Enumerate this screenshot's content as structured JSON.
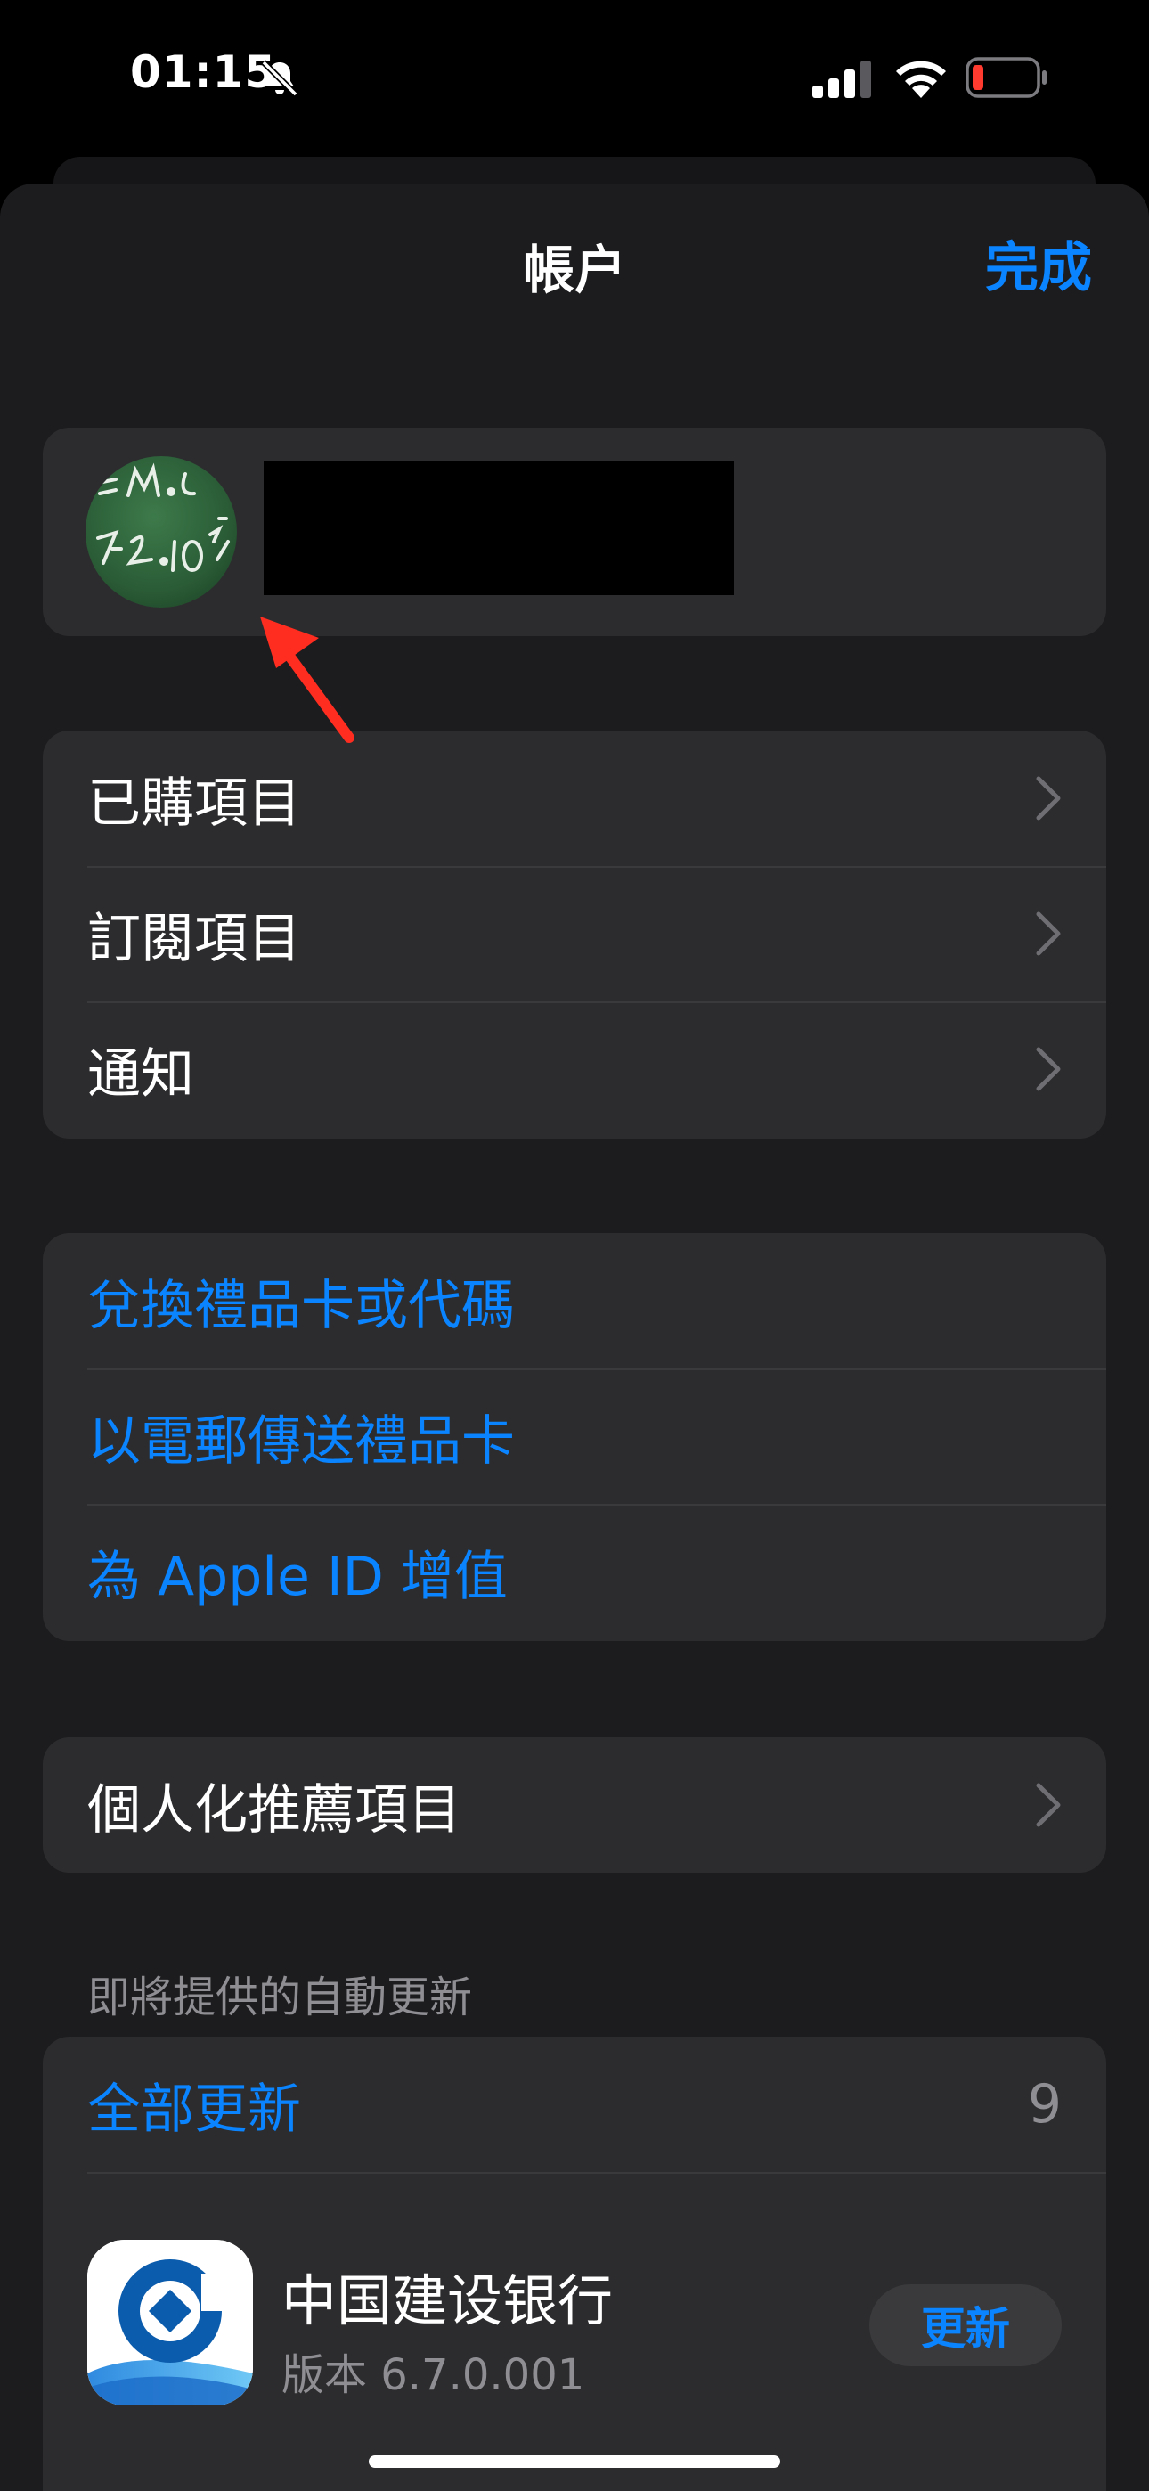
{
  "status_bar": {
    "time": "01:15",
    "battery_color": "#ff3b30"
  },
  "nav": {
    "title": "帳户",
    "done_label": "完成"
  },
  "purchases_section": {
    "items": [
      {
        "label": "已購項目"
      },
      {
        "label": "訂閱項目"
      },
      {
        "label": "通知"
      }
    ]
  },
  "gift_section": {
    "items": [
      {
        "label": "兌換禮品卡或代碼"
      },
      {
        "label": "以電郵傳送禮品卡"
      },
      {
        "label": "為 Apple ID 增值"
      }
    ]
  },
  "personalized": {
    "label": "個人化推薦項目"
  },
  "updates": {
    "section_header": "即將提供的自動更新",
    "update_all_label": "全部更新",
    "count": "9",
    "apps": [
      {
        "name": "中国建设银行",
        "version": "版本 6.7.0.001",
        "button_label": "更新"
      }
    ]
  },
  "colors": {
    "accent": "#0a84ff",
    "annotation_arrow": "#ff2d20"
  }
}
